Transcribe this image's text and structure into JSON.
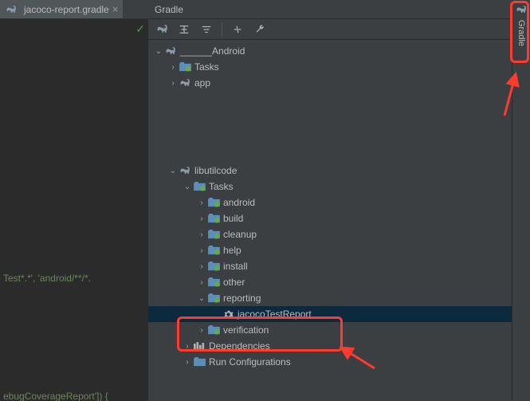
{
  "editor": {
    "tab_label": "jacoco-report.gradle",
    "check": "✓",
    "line1": "Test*.*', 'android/**/*.",
    "line2": "ebugCoverageReport']) {"
  },
  "panel": {
    "title": "Gradle"
  },
  "sidebar": {
    "label": "Gradle"
  },
  "tree": {
    "root": "______Android",
    "root_tasks": "Tasks",
    "root_app": "app",
    "lib": "libutilcode",
    "lib_tasks": "Tasks",
    "t_android": "android",
    "t_build": "build",
    "t_cleanup": "cleanup",
    "t_help": "help",
    "t_install": "install",
    "t_other": "other",
    "t_reporting": "reporting",
    "task_jacoco": "jacocoTestReport",
    "t_verification": "verification",
    "deps": "Dependencies",
    "runconf": "Run Configurations"
  }
}
